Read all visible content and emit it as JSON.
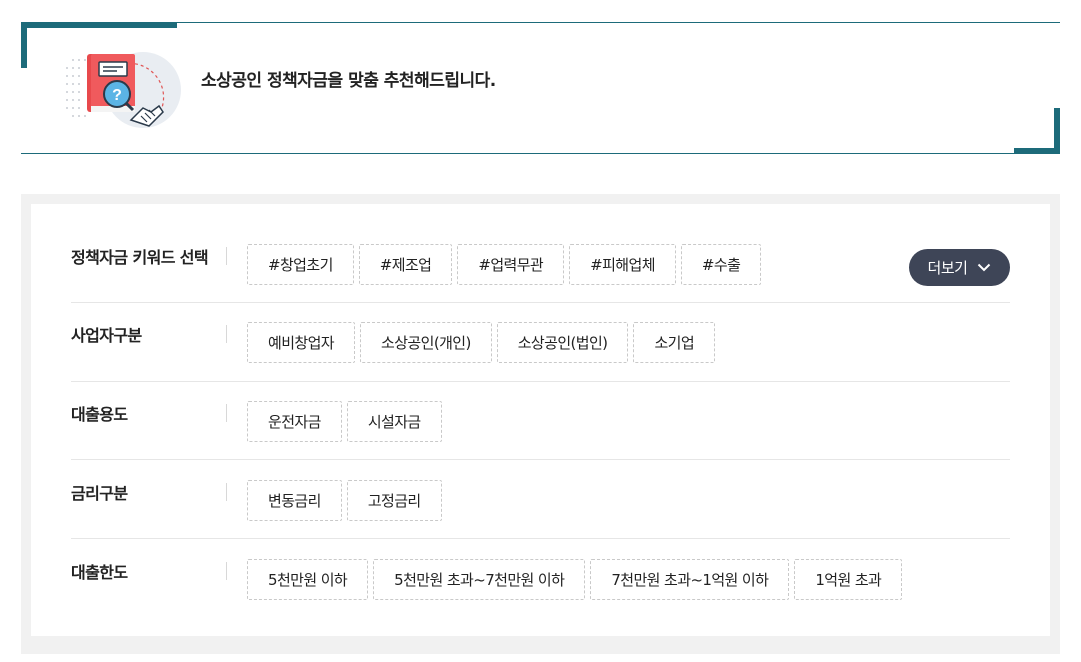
{
  "banner": {
    "title": "소상공인 정책자금을 맞춤 추천해드립니다."
  },
  "colors": {
    "accent": "#1d6b7a",
    "more_button_bg": "#3e4557",
    "panel_bg": "#f1f1f1"
  },
  "filters": {
    "more_label": "더보기",
    "rows": [
      {
        "label": "정책자금 키워드 선택",
        "chips": [
          "#창업초기",
          "#제조업",
          "#업력무관",
          "#피해업체",
          "#수출"
        ]
      },
      {
        "label": "사업자구분",
        "chips": [
          "예비창업자",
          "소상공인(개인)",
          "소상공인(법인)",
          "소기업"
        ]
      },
      {
        "label": "대출용도",
        "chips": [
          "운전자금",
          "시설자금"
        ]
      },
      {
        "label": "금리구분",
        "chips": [
          "변동금리",
          "고정금리"
        ]
      },
      {
        "label": "대출한도",
        "chips": [
          "5천만원 이하",
          "5천만원 초과~7천만원 이하",
          "7천만원 초과~1억원 이하",
          "1억원 초과"
        ]
      }
    ]
  }
}
